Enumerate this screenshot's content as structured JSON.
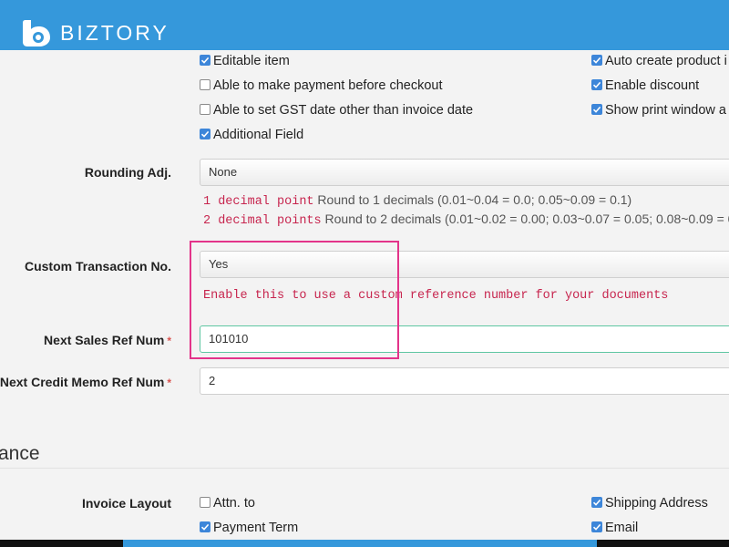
{
  "header": {
    "brand": "BIZTORY",
    "bar_color": "#3598db"
  },
  "options": {
    "left": [
      {
        "label": "Editable item",
        "checked": true
      },
      {
        "label": "Able to make payment before checkout",
        "checked": false
      },
      {
        "label": "Able to set GST date other than invoice date",
        "checked": false
      },
      {
        "label": "Additional Field",
        "checked": true
      }
    ],
    "right": [
      {
        "label": "Auto create product i",
        "checked": true
      },
      {
        "label": "Enable discount",
        "checked": true
      },
      {
        "label": "Show print window a",
        "checked": true
      }
    ]
  },
  "rounding": {
    "label": "Rounding Adj.",
    "value": "None",
    "help": [
      {
        "code": "1 decimal point",
        "text": "Round to 1 decimals (0.01~0.04 = 0.0; 0.05~0.09 = 0.1)"
      },
      {
        "code": "2 decimal points",
        "text": "Round to 2 decimals (0.01~0.02 = 0.00; 0.03~0.07 = 0.05; 0.08~0.09 = 0"
      }
    ]
  },
  "custom_txn": {
    "label": "Custom Transaction No.",
    "value": "Yes",
    "help": "Enable this to use a custom reference number for your documents"
  },
  "next_sales": {
    "label": "Next Sales Ref Num",
    "required": "*",
    "value": "101010"
  },
  "next_credit": {
    "label": "Next Credit Memo Ref Num",
    "required": "*",
    "value": "2"
  },
  "section": {
    "title": "ance"
  },
  "invoice_layout": {
    "label": "Invoice Layout",
    "left": [
      {
        "label": "Attn. to",
        "checked": false
      },
      {
        "label": "Payment Term",
        "checked": true
      }
    ],
    "right": [
      {
        "label": "Shipping Address",
        "checked": true
      },
      {
        "label": "Email",
        "checked": true
      }
    ]
  },
  "colors": {
    "checkbox": "#3d86d9",
    "highlight": "#e3348a",
    "help_code": "#c7254e",
    "focus_border": "#5fc6a2"
  }
}
